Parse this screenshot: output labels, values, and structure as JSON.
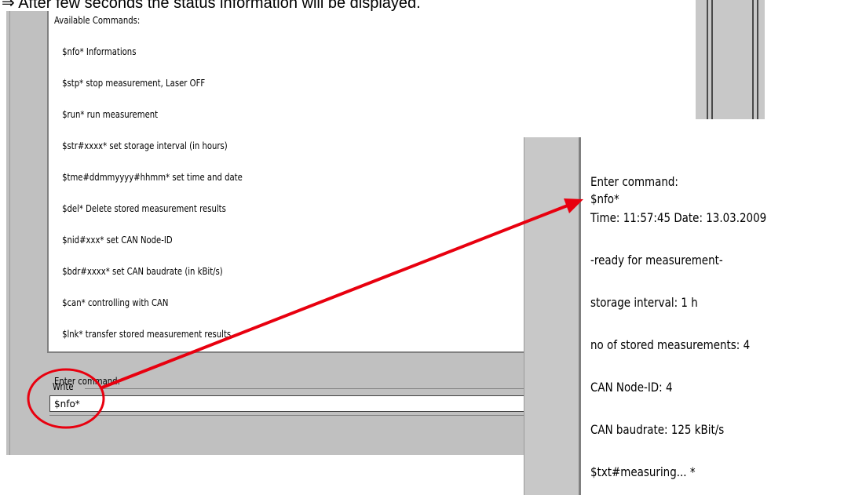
{
  "header": {
    "text": "⇒ After few seconds the status information will be displayed."
  },
  "console": {
    "heading": "Available Commands:",
    "commands": [
      "$nfo*  Informations",
      "$stp*  stop measurement, Laser OFF",
      "$run*  run measurement",
      "$str#xxxx*  set storage interval (in hours)",
      "$tme#ddmmyyyy#hhmm*  set time and date",
      "$del*  Delete stored measurement results",
      "$nid#xxx*  set CAN Node-ID",
      "$bdr#xxxx*  set CAN baudrate (in kBit/s)",
      "$can*  controlling with CAN",
      "$lnk*  transfer stored measurement results"
    ],
    "prompt": "Enter command:"
  },
  "write": {
    "label": "Write",
    "value": "$nfo*"
  },
  "status": {
    "lines": [
      "Enter command:",
      "$nfo*",
      "Time: 11:57:45   Date: 13.03.2009",
      "-ready for measurement-",
      "storage interval: 1 h",
      "no of stored measurements: 4",
      "CAN Node-ID: 4",
      "CAN baudrate: 125 kBit/s",
      "$txt#measuring... *"
    ]
  },
  "annotation": {
    "color": "#e8000f"
  }
}
